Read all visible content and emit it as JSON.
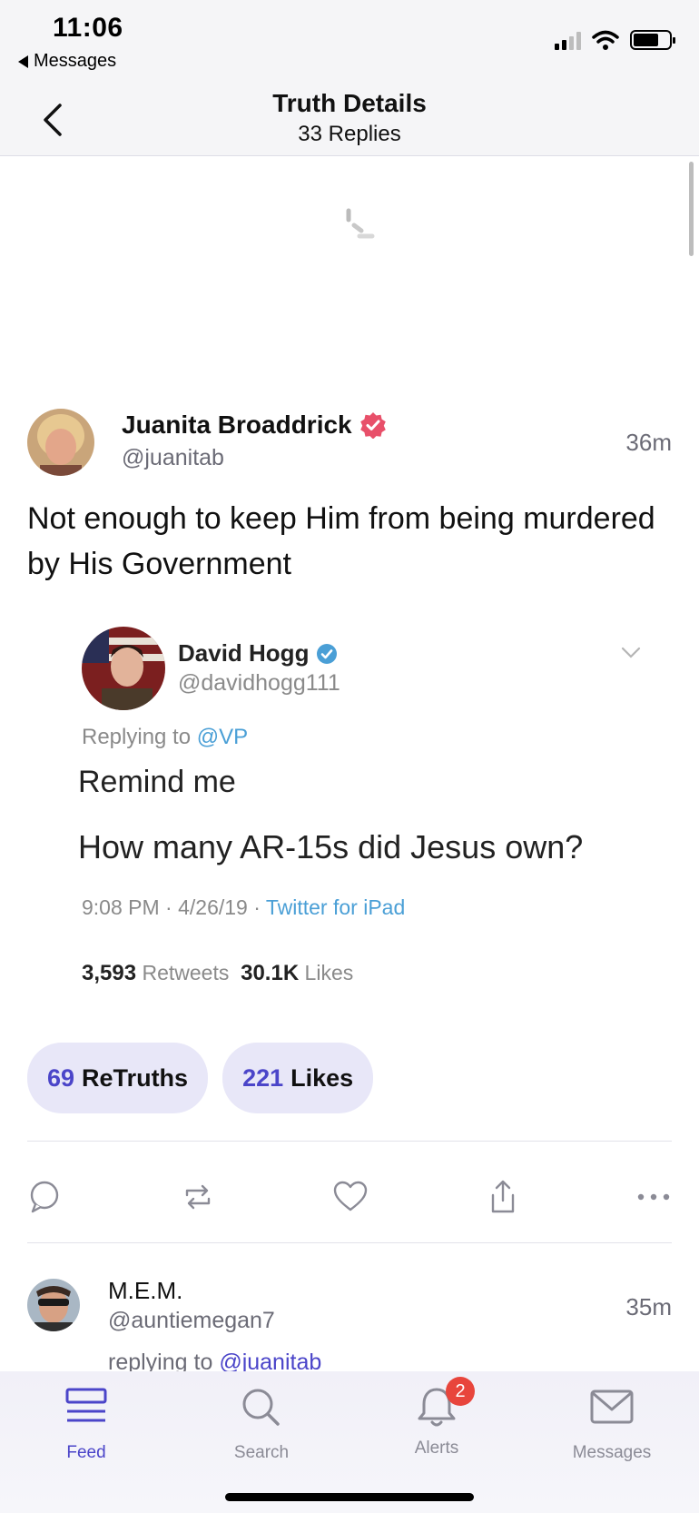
{
  "status_bar": {
    "time": "11:06",
    "back_app": "Messages"
  },
  "nav": {
    "title": "Truth Details",
    "subtitle": "33 Replies"
  },
  "post": {
    "author_name": "Juanita Broaddrick",
    "author_handle": "@juanitab",
    "time": "36m",
    "text": "Not enough to keep Him from being murdered by His Government",
    "verified": true
  },
  "embedded": {
    "name": "David Hogg",
    "handle": "@davidhogg111",
    "replying_label": "Replying to",
    "replying_to": "@VP",
    "line1": "Remind me",
    "line2": "How many AR-15s did Jesus own?",
    "timestamp": "9:08 PM · 4/26/19 · ",
    "source": "Twitter for iPad",
    "retweets_count": "3,593",
    "retweets_label": "Retweets",
    "likes_count": "30.1K",
    "likes_label": "Likes"
  },
  "stats": {
    "retruths_count": "69",
    "retruths_label": "ReTruths",
    "likes_count": "221",
    "likes_label": "Likes"
  },
  "reply": {
    "name": "M.E.M.",
    "handle": "@auntiemegan7",
    "time": "35m",
    "replying_label": "replying to",
    "replying_to": "@juanitab"
  },
  "tabs": [
    {
      "label": "Feed",
      "icon": "feed-icon",
      "active": true
    },
    {
      "label": "Search",
      "icon": "search-icon"
    },
    {
      "label": "Alerts",
      "icon": "bell-icon",
      "badge": "2"
    },
    {
      "label": "Messages",
      "icon": "envelope-icon"
    }
  ],
  "colors": {
    "accent": "#4b45c9",
    "pill_bg": "#e8e7f8",
    "verified": "#e8506a",
    "twitter_blue": "#4a9fd6",
    "badge": "#e8453c"
  }
}
